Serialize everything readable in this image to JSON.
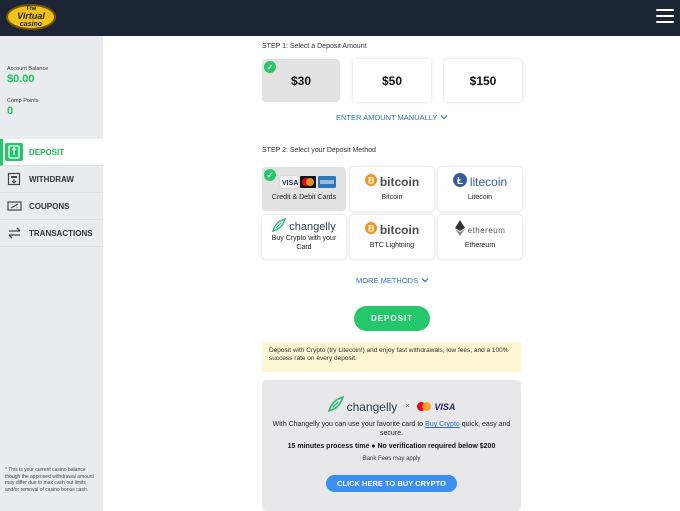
{
  "header": {
    "logo_line1": "The",
    "logo_line2": "Virtual",
    "logo_line3": "casino"
  },
  "sidebar": {
    "account_balance_label": "Account Balance",
    "account_balance_value": "$0.00",
    "comp_points_label": "Comp Points",
    "comp_points_value": "0",
    "nav": [
      {
        "label": "DEPOSIT",
        "icon": "deposit-icon",
        "active": true
      },
      {
        "label": "WITHDRAW",
        "icon": "withdraw-icon",
        "active": false
      },
      {
        "label": "COUPONS",
        "icon": "coupon-icon",
        "active": false
      },
      {
        "label": "TRANSACTIONS",
        "icon": "transactions-icon",
        "active": false
      }
    ],
    "disclaimer": "* This is your current casino balance though the approved withdrawal amount may differ due to max cash out limits and/or removal of casino bonus cash."
  },
  "step1": {
    "title": "STEP 1: Select a Deposit Amount",
    "amounts": [
      "$30",
      "$50",
      "$150"
    ],
    "selected_amount": "$30",
    "manual_label": "ENTER AMOUNT MANUALLY"
  },
  "step2": {
    "title": "STEP 2: Select your Deposit Method",
    "methods": [
      {
        "name": "Credit & Debit Cards",
        "logo": "cards",
        "selected": true
      },
      {
        "name": "Bitcoin",
        "logo": "bitcoin",
        "logo_text": "bitcoin"
      },
      {
        "name": "Litecoin",
        "logo": "litecoin",
        "logo_text": "litecoin"
      },
      {
        "name": "Buy Crypto with your Card",
        "logo": "changelly",
        "logo_text": "changelly"
      },
      {
        "name": "BTC Lightning",
        "logo": "bitcoin-lightning",
        "logo_text": "bitcoin"
      },
      {
        "name": "Ethereum",
        "logo": "ethereum",
        "logo_text": "ethereum"
      }
    ],
    "more_label": "MORE METHODS"
  },
  "deposit_button": "DEPOSIT",
  "promo_text": "Deposit with Crypto (try Litecoin!) and enjoy fast withdrawals, low fees, and a 100% success rate on every deposit.",
  "buy_crypto": {
    "brand": "changelly",
    "times": "×",
    "visa": "VISA",
    "text_before": "With Changelly you can use your favorite card to ",
    "link": "Buy Crypto",
    "text_after": " quick, easy and secure.",
    "bold_line": "15 minutes process time ● No verification required below $200",
    "fees": "Bank Fees may apply",
    "button": "CLICK HERE TO BUY CRYPTO"
  },
  "colors": {
    "topbar": "#1b2536",
    "accent_green": "#24c76a",
    "link_blue": "#2d6fd6",
    "button_blue": "#3a8ff0",
    "sidebar_bg": "#e9ecef",
    "promo_bg": "#fcf6d3"
  }
}
